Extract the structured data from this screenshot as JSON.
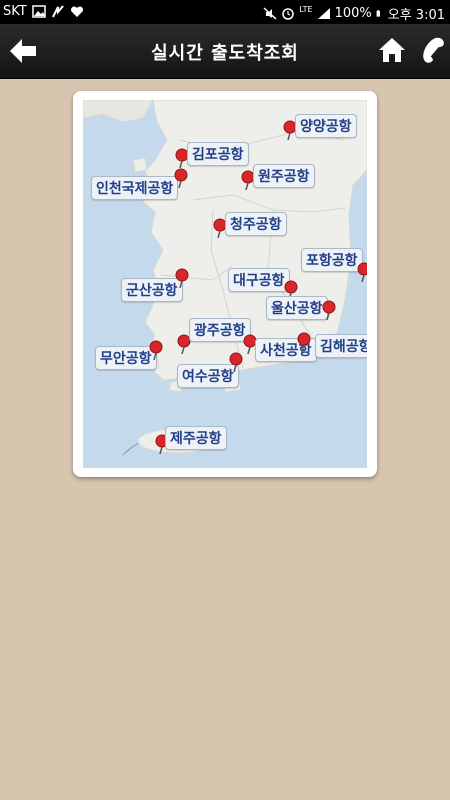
{
  "status": {
    "carrier": "SKT",
    "network": "LTE",
    "battery": "100%",
    "time": "오후 3:01"
  },
  "header": {
    "title": "실시간 출도착조회",
    "icons": [
      "back-arrow-icon",
      "home-icon",
      "phone-icon"
    ]
  },
  "colors": {
    "sea": "#c5d9ec",
    "land": "#eeeeea",
    "label_text": "#1f3f87",
    "pin": "#d9262b",
    "background": "#d8c5b0"
  },
  "airports": [
    {
      "id": "yangyang",
      "name": "양양공항"
    },
    {
      "id": "gimpo",
      "name": "김포공항"
    },
    {
      "id": "wonju",
      "name": "원주공항"
    },
    {
      "id": "incheon",
      "name": "인천국제공항"
    },
    {
      "id": "cheongju",
      "name": "청주공항"
    },
    {
      "id": "pohang",
      "name": "포항공항"
    },
    {
      "id": "daegu",
      "name": "대구공항"
    },
    {
      "id": "gunsan",
      "name": "군산공항"
    },
    {
      "id": "ulsan",
      "name": "울산공항"
    },
    {
      "id": "gwangju",
      "name": "광주공항"
    },
    {
      "id": "muan",
      "name": "무안공항"
    },
    {
      "id": "sacheon",
      "name": "사천공항"
    },
    {
      "id": "gimhae",
      "name": "김해공항"
    },
    {
      "id": "yeosu",
      "name": "여수공항"
    },
    {
      "id": "jeju",
      "name": "제주공항"
    }
  ]
}
